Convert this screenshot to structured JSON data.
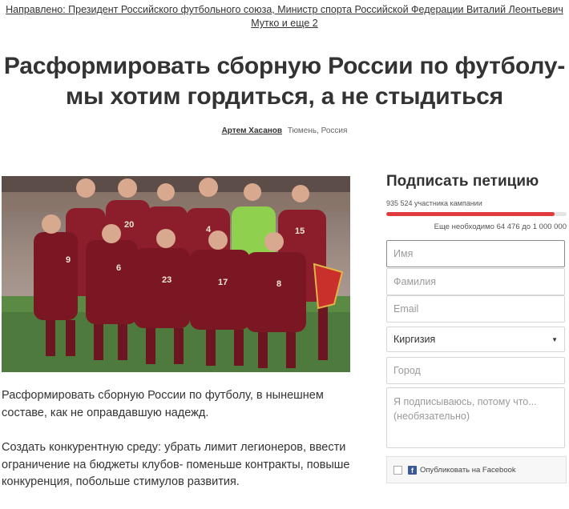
{
  "header": {
    "directed_line1": "Направлено: Президент Российского футбольного союза, Министр спорта Российской Федерации Виталий Леонтьевич",
    "directed_line2": "Мутко и еще 2"
  },
  "petition": {
    "title_line1": "Расформировать сборную России по футболу-",
    "title_line2": "мы хотим гордиться, а не стыдиться",
    "author_name": "Артем Хасанов",
    "author_location": "Тюмень, Россия",
    "photo_icon": "team-photo",
    "description_p1": "Расформировать сборную России по футболу, в нынешнем составе, как не оправдавшую надежд.",
    "description_p2": "Создать конкурентную среду: убрать лимит легионеров, ввести ограничение на бюджеты клубов- поменьше контракты, повыше конкуренция, побольше стимулов развития."
  },
  "sign": {
    "title": "Подписать петицию",
    "count_text": "935 524 участника кампании",
    "needed_text": "Еще необходимо 64 476 до 1 000 000",
    "progress_percent": 93.5,
    "progress_color": "#e13b3f",
    "first_name_placeholder": "Имя",
    "last_name_placeholder": "Фамилия",
    "email_placeholder": "Email",
    "country_value": "Киргизия",
    "city_placeholder": "Город",
    "reason_placeholder": "Я подписываюсь, потому что... (необязательно)",
    "facebook_label": "Опубликовать на Facebook",
    "facebook_color": "#3b5998"
  }
}
